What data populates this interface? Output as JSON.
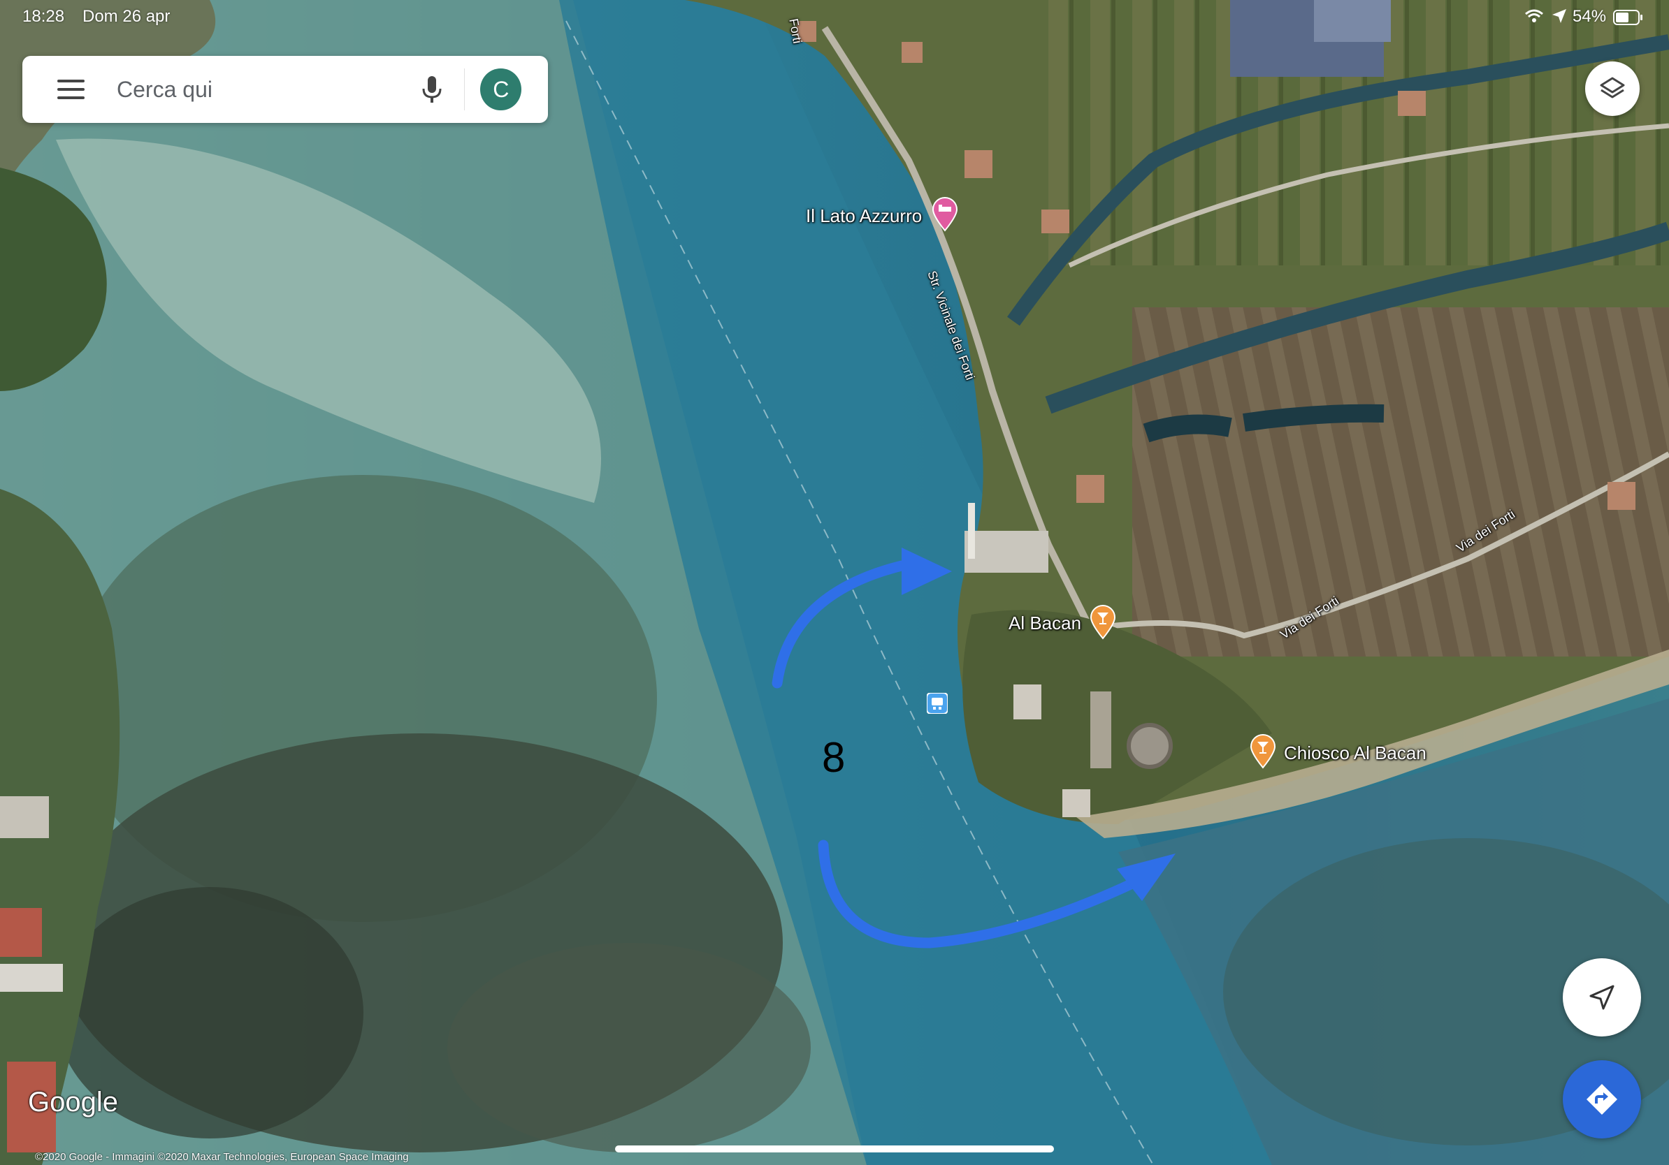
{
  "status_bar": {
    "time": "18:28",
    "date": "Dom 26 apr",
    "battery": "54%"
  },
  "search": {
    "placeholder": "Cerca qui",
    "avatar_letter": "C"
  },
  "map": {
    "labels": {
      "poi_hotel": "Il Lato Azzurro",
      "poi_bar": "Al Bacan",
      "poi_kiosk": "Chiosco Al Bacan",
      "road_forti_top": "Forti",
      "road_vicinale": "Str. Vicinale dei Forti",
      "road_via_forti_1": "Via dei Forti",
      "road_via_forti_2": "Via dei Forti"
    },
    "annotation_number": "8",
    "annotation_color": "#2f6fe8",
    "pin_lodging_color": "#e05ba0",
    "pin_bar_color": "#f0963c",
    "transit_icon_color": "#4aa3ee"
  },
  "branding": {
    "logo": "Google",
    "attribution": "©2020 Google - Immagini ©2020 Maxar Technologies, European Space Imaging"
  },
  "icons": {
    "layers": "layers-icon",
    "my_location": "navigation-arrow-icon",
    "directions": "directions-icon",
    "menu": "hamburger-icon",
    "mic": "mic-icon"
  }
}
